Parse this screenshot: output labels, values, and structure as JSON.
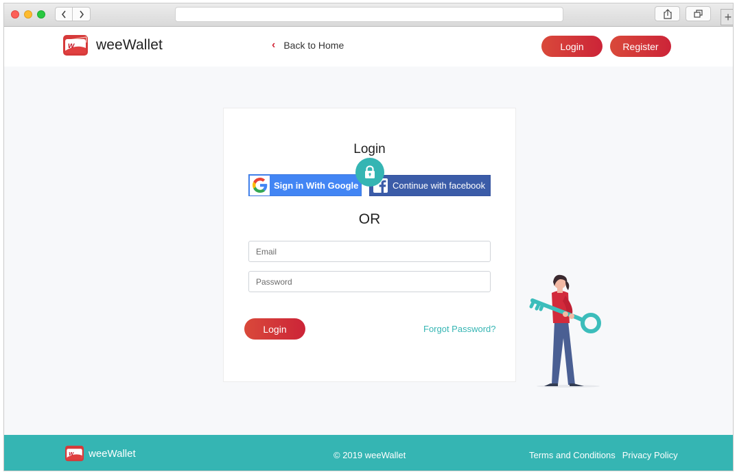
{
  "site": {
    "brand": "weeWallet",
    "back_home": "Back to Home",
    "header_login": "Login",
    "header_register": "Register"
  },
  "login_card": {
    "title": "Login",
    "google_label": "Sign in With Google",
    "facebook_label": "Continue with facebook",
    "or_text": "OR",
    "email_placeholder": "Email",
    "email_value": "",
    "password_placeholder": "Password",
    "password_value": "",
    "login_button": "Login",
    "forgot_password": "Forgot Password?"
  },
  "footer": {
    "brand": "weeWallet",
    "copyright": "© 2019 weeWallet",
    "terms": "Terms and Conditions",
    "privacy": "Privacy Policy"
  },
  "icons": {
    "lock": "lock-icon",
    "google": "google-icon",
    "facebook": "facebook-icon",
    "back": "chevron-left-icon",
    "logo": "wallet-logo-icon"
  },
  "colors": {
    "accent_red": "#cc2438",
    "accent_teal": "#35b5b3",
    "google_blue": "#4285f4",
    "facebook_blue": "#3b5ca8"
  }
}
